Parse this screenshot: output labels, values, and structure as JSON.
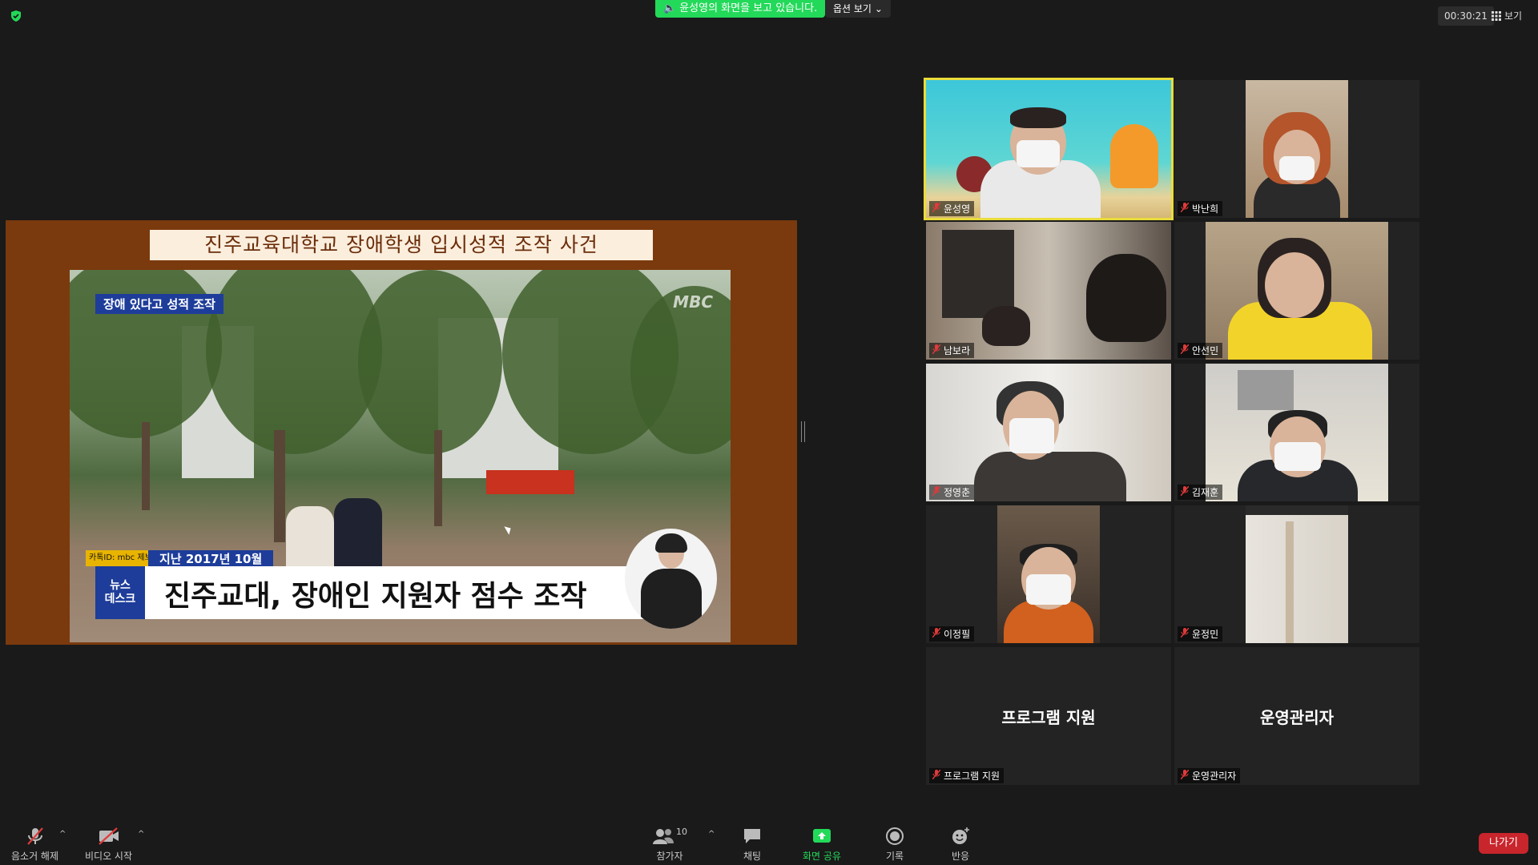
{
  "topbar": {
    "sharing_banner": "윤성영의 화면을 보고 있습니다.",
    "view_options": "옵션 보기",
    "timer": "00:30:21",
    "view_button": "보기"
  },
  "shared_screen": {
    "slide_title": "진주교육대학교 장애학생 입시성적 조작 사건",
    "video_tag": "장애 있다고 성적 조작",
    "broadcaster_mark": "MBC",
    "news_source": "카톡ID: mbc 제보",
    "news_date": "지난 2017년 10월",
    "news_logo_top": "뉴스",
    "news_logo_bottom": "데스크",
    "headline": "진주교대, 장애인 지원자 점수 조작"
  },
  "participants": [
    {
      "name": "윤성영",
      "muted": true,
      "active": true
    },
    {
      "name": "박난희",
      "muted": true
    },
    {
      "name": "남보라",
      "muted": true
    },
    {
      "name": "안선민",
      "muted": true
    },
    {
      "name": "정영춘",
      "muted": true
    },
    {
      "name": "김재훈",
      "muted": true
    },
    {
      "name": "이정필",
      "muted": true
    },
    {
      "name": "윤정민",
      "muted": true
    },
    {
      "name": "프로그램 지원",
      "muted": true,
      "display_name": "프로그램 지원"
    },
    {
      "name": "운영관리자",
      "muted": true,
      "display_name": "운영관리자"
    }
  ],
  "toolbar": {
    "unmute": "음소거 해제",
    "start_video": "비디오 시작",
    "participants": "참가자",
    "participant_count": "10",
    "chat": "채팅",
    "share_screen": "화면 공유",
    "record": "기록",
    "reactions": "반응",
    "leave": "나가기"
  },
  "colors": {
    "share_green": "#23d959",
    "active_speaker": "#e9dc3b",
    "leave_red": "#c8252c",
    "slide_brown": "#7a3a0d"
  }
}
